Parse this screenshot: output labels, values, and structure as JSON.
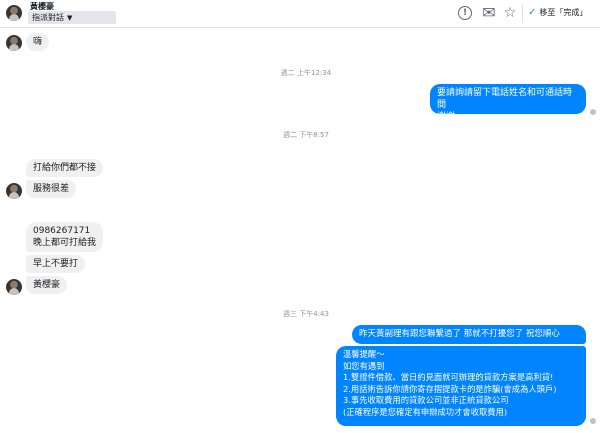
{
  "header": {
    "name": "黃櫻豪",
    "assign_label": "指派對話",
    "info_icon": "info-icon",
    "mail_icon": "mail-icon",
    "star_icon": "star-icon",
    "done_label": "移至「完成」",
    "check_icon": "check-icon"
  },
  "timestamps": [
    "週二 上午12:34",
    "週二 下午8:57",
    "週三 下午4:43"
  ],
  "messages": {
    "m1": "嗨",
    "m2_l1": "要請詢請留下電話姓名和可通話時間",
    "m2_l2": "謝謝",
    "m3": "打給你們都不接",
    "m4": "服務很差",
    "m5_l1": "0986267171",
    "m5_l2": "晚上都可打給我",
    "m6": "早上不要打",
    "m7": "黃櫻豪",
    "m8": "昨天黃副理有跟您聯繫過了  那就不打擾您了  祝您順心",
    "m9": [
      "溫馨提醒～",
      "如您有遇到",
      "1.雙證件借款、當日約見面就可辦理的貸款方案是高利貸!",
      "2.用話術告訴你請你寄存摺提款卡的是詐騙(會成為人頭戶)",
      "3.事先收取費用的貸款公司並非正統貸款公司",
      "(正確程序是您確定有申辦成功才會收取費用)"
    ]
  },
  "colors": {
    "outgoing": "#0084ff",
    "incoming": "#f1f0f0",
    "done_check": "#31a24c"
  }
}
